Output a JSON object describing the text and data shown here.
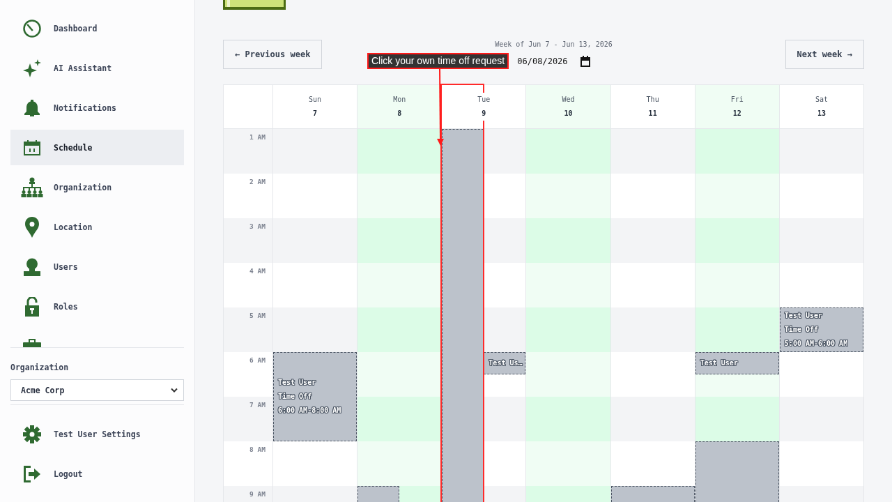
{
  "sidebar": {
    "items": [
      {
        "label": "Dashboard",
        "selected": false
      },
      {
        "label": "AI Assistant",
        "selected": false
      },
      {
        "label": "Notifications",
        "selected": false
      },
      {
        "label": "Schedule",
        "selected": true
      },
      {
        "label": "Organization",
        "selected": false
      },
      {
        "label": "Location",
        "selected": false
      },
      {
        "label": "Users",
        "selected": false
      },
      {
        "label": "Roles",
        "selected": false
      },
      {
        "selected": false
      }
    ],
    "organization": {
      "label": "Organization",
      "value": "Acme Corp"
    },
    "footer_items": [
      {
        "label": "Test User Settings"
      },
      {
        "label": "Logout"
      }
    ]
  },
  "week_nav": {
    "previous": "← Previous week",
    "title": "Week of Jun 7 - Jun 13, 2026",
    "date": "06/08/2026",
    "next": "Next week →"
  },
  "tutorial_hint": {
    "text": "Click your own time off request"
  },
  "calendar": {
    "days": [
      {
        "name": "Sun",
        "date": "7",
        "highlighted": false
      },
      {
        "name": "Mon",
        "date": "8",
        "highlighted": true
      },
      {
        "name": "Tue",
        "date": "9",
        "highlighted": false
      },
      {
        "name": "Wed",
        "date": "10",
        "highlighted": true
      },
      {
        "name": "Thu",
        "date": "11",
        "highlighted": false
      },
      {
        "name": "Fri",
        "date": "12",
        "highlighted": true
      },
      {
        "name": "Sat",
        "date": "13",
        "highlighted": false
      }
    ],
    "rows": [
      {
        "label": "1 AM",
        "tue": [
          {
            "kind": "open",
            "narrow": true
          }
        ]
      },
      {
        "label": "2 AM"
      },
      {
        "label": "3 AM"
      },
      {
        "label": "4 AM"
      },
      {
        "label": "5 AM",
        "sat": [
          {
            "kind": "hour",
            "narrow": false,
            "title": "Test User",
            "type": "Time Off",
            "time": "5:00 AM-6:00 AM"
          }
        ]
      },
      {
        "label": "6 AM",
        "sun": [
          {
            "kind": "double",
            "narrow": false,
            "title": "Test User",
            "type": "Time Off",
            "time": "6:00 AM-8:00 AM"
          }
        ],
        "tue": [
          {
            "kind": "half",
            "narrow": true,
            "title": "Test Us…"
          }
        ],
        "fri": [
          {
            "kind": "half",
            "narrow": false,
            "title": "Test User"
          }
        ]
      },
      {
        "label": "7 AM"
      },
      {
        "label": "8 AM",
        "fri": [
          {
            "kind": "open",
            "narrow": false
          }
        ]
      },
      {
        "label": "9 AM",
        "mon": [
          {
            "kind": "open",
            "narrow": true
          }
        ],
        "thu": [
          {
            "kind": "open",
            "narrow": false
          }
        ]
      }
    ]
  }
}
